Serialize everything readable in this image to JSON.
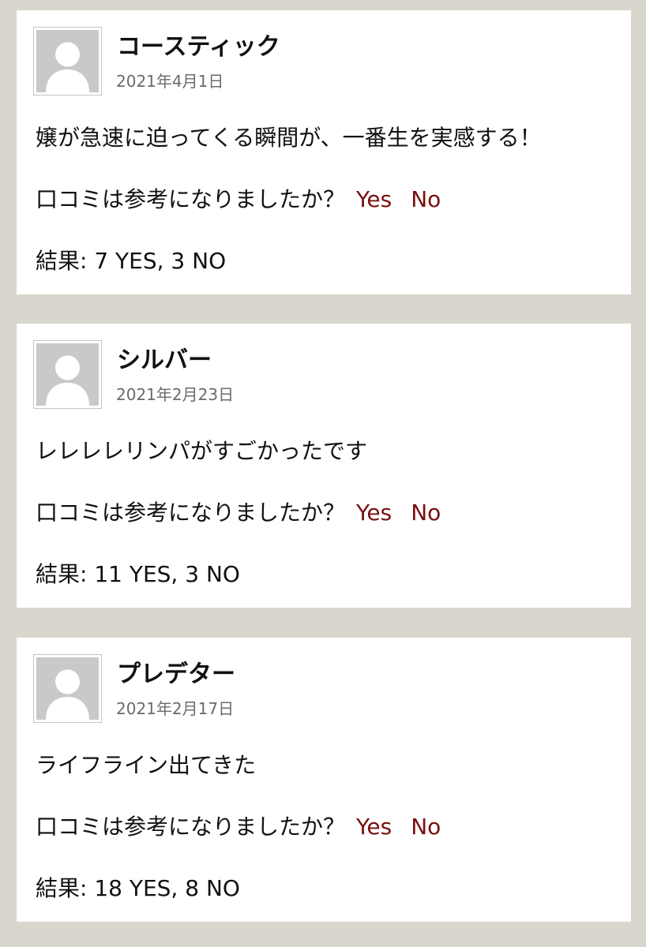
{
  "colors": {
    "page_background": "#d9d7cd",
    "card_background": "#ffffff",
    "vote_link": "#7a1010",
    "date_text": "#6b6b6b"
  },
  "avatar_icon": "default-user-silhouette-icon",
  "reviews": [
    {
      "name": "コースティック",
      "date": "2021年4月1日",
      "comment": "嬢が急速に迫ってくる瞬間が、一番生を実感する！",
      "helpful_question": "口コミは参考になりましたか？",
      "yes_label": "Yes",
      "no_label": "No",
      "result": "結果: 7 YES, 3 NO"
    },
    {
      "name": "シルバー",
      "date": "2021年2月23日",
      "comment": "レレレレリンパがすごかったです",
      "helpful_question": "口コミは参考になりましたか？",
      "yes_label": "Yes",
      "no_label": "No",
      "result": "結果: 11 YES, 3 NO"
    },
    {
      "name": "プレデター",
      "date": "2021年2月17日",
      "comment": "ライフライン出てきた",
      "helpful_question": "口コミは参考になりましたか？",
      "yes_label": "Yes",
      "no_label": "No",
      "result": "結果: 18 YES, 8 NO"
    }
  ]
}
